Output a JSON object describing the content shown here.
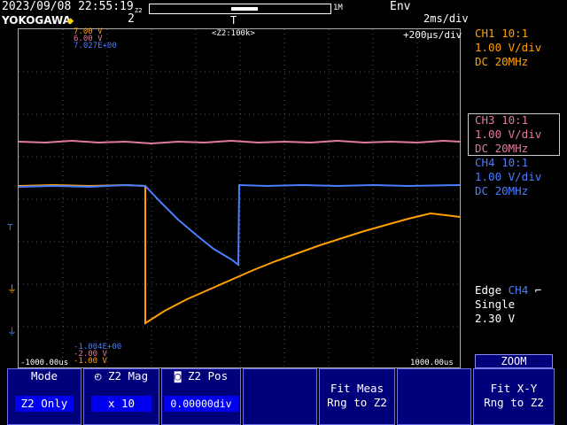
{
  "header": {
    "timestamp": "2023/09/08 22:55:19",
    "brand": "YOKOGAWA",
    "zoom_small": "Z2",
    "zoom_index": "2",
    "bar_mark": "1M",
    "mode": "Env",
    "trigger_mark": "T",
    "time_div": "2ms/div"
  },
  "overlay": {
    "top_values": [
      "7.00 V",
      "6.00 V",
      "7.027E+00"
    ],
    "zoom_label": "<Z2:100k>",
    "zoom_div": "+200μs/div",
    "bottom_values": [
      "-1.004E+00",
      "-2.00 V",
      "-1.00 V"
    ],
    "time_left": "-1000.00us",
    "time_right": "1000.00us"
  },
  "channels": [
    {
      "name": "CH1 10:1",
      "scale": "1.00 V/div",
      "coupling": "DC   20MHz",
      "color": "#ffa000"
    },
    {
      "name": "CH3 10:1",
      "scale": "1.00 V/div",
      "coupling": "DC   20MHz",
      "color": "#e07aa0"
    },
    {
      "name": "CH4 10:1",
      "scale": "1.00 V/div",
      "coupling": "DC   20MHz",
      "color": "#4a7dff"
    }
  ],
  "trigger": {
    "type_prefix": "Edge",
    "source": "CH4",
    "mode": "Single",
    "level": "2.30 V"
  },
  "softkeys": {
    "mode": {
      "label": "Mode",
      "value": "Z2 Only"
    },
    "mag": {
      "label": "Z2 Mag",
      "value": "x 10"
    },
    "pos": {
      "label": "Z2 Pos",
      "value": "0.00000div"
    },
    "fit_meas": {
      "line1": "Fit Meas",
      "line2": "Rng to Z2"
    },
    "zoom_header": "ZOOM",
    "fit_xy": {
      "line1": "Fit X-Y",
      "line2": "Rng to Z2"
    }
  },
  "colors": {
    "ch1": "#ffa000",
    "ch3": "#e07aa0",
    "ch4": "#4a7dff",
    "softkey_bg": "#00007a"
  }
}
